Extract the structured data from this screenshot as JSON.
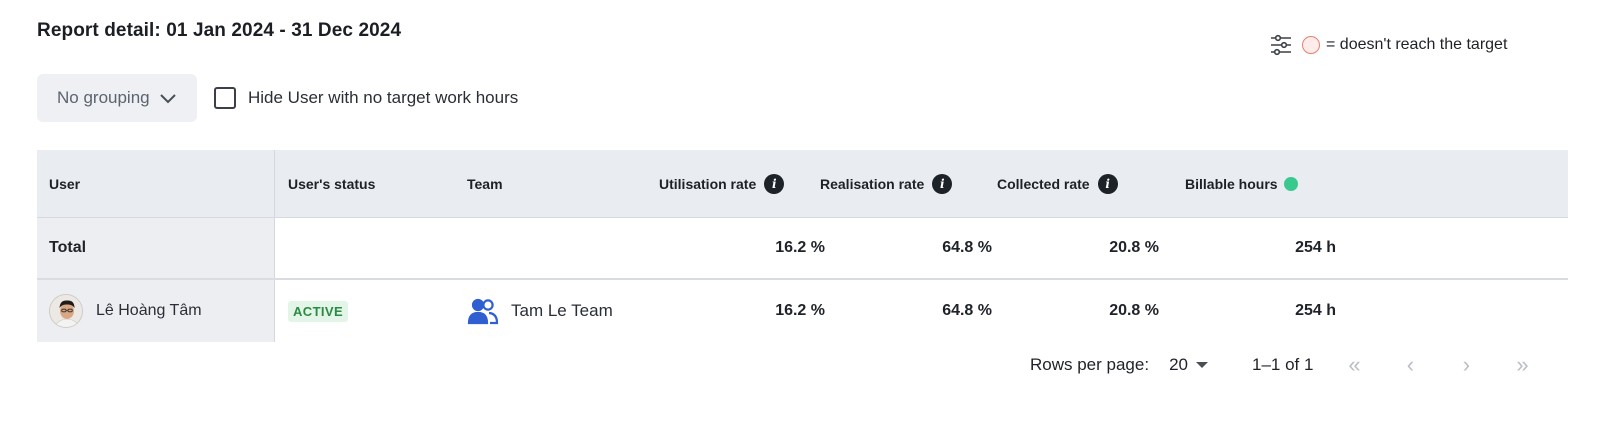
{
  "title": "Report detail: 01 Jan 2024 - 31 Dec 2024",
  "legend": {
    "text": "= doesn't reach the target",
    "icon": "filter-settings-icon"
  },
  "toolbar": {
    "grouping_value": "No grouping",
    "hide_checkbox_label": "Hide User with no target work hours",
    "hide_checkbox_checked": false
  },
  "table": {
    "headers": {
      "user": "User",
      "status": "User's status",
      "team": "Team",
      "utilisation": "Utilisation rate",
      "realisation": "Realisation rate",
      "collected": "Collected rate",
      "billable": "Billable hours"
    },
    "total": {
      "label": "Total",
      "utilisation": "16.2 %",
      "realisation": "64.8 %",
      "collected": "20.8 %",
      "billable": "254 h"
    },
    "rows": [
      {
        "user": "Lê Hoàng Tâm",
        "status": "ACTIVE",
        "team": "Tam Le Team",
        "utilisation": "16.2 %",
        "realisation": "64.8 %",
        "collected": "20.8 %",
        "billable": "254 h"
      }
    ]
  },
  "pagination": {
    "rows_per_page_label": "Rows per page:",
    "rows_per_page_value": "20",
    "range": "1–1 of 1"
  },
  "colors": {
    "target_miss": "#e8806e",
    "billable_dot": "#38c98f",
    "active_badge_bg": "#e3f5e6",
    "active_badge_text": "#2b8a45",
    "team_icon": "#2f5fd0"
  }
}
